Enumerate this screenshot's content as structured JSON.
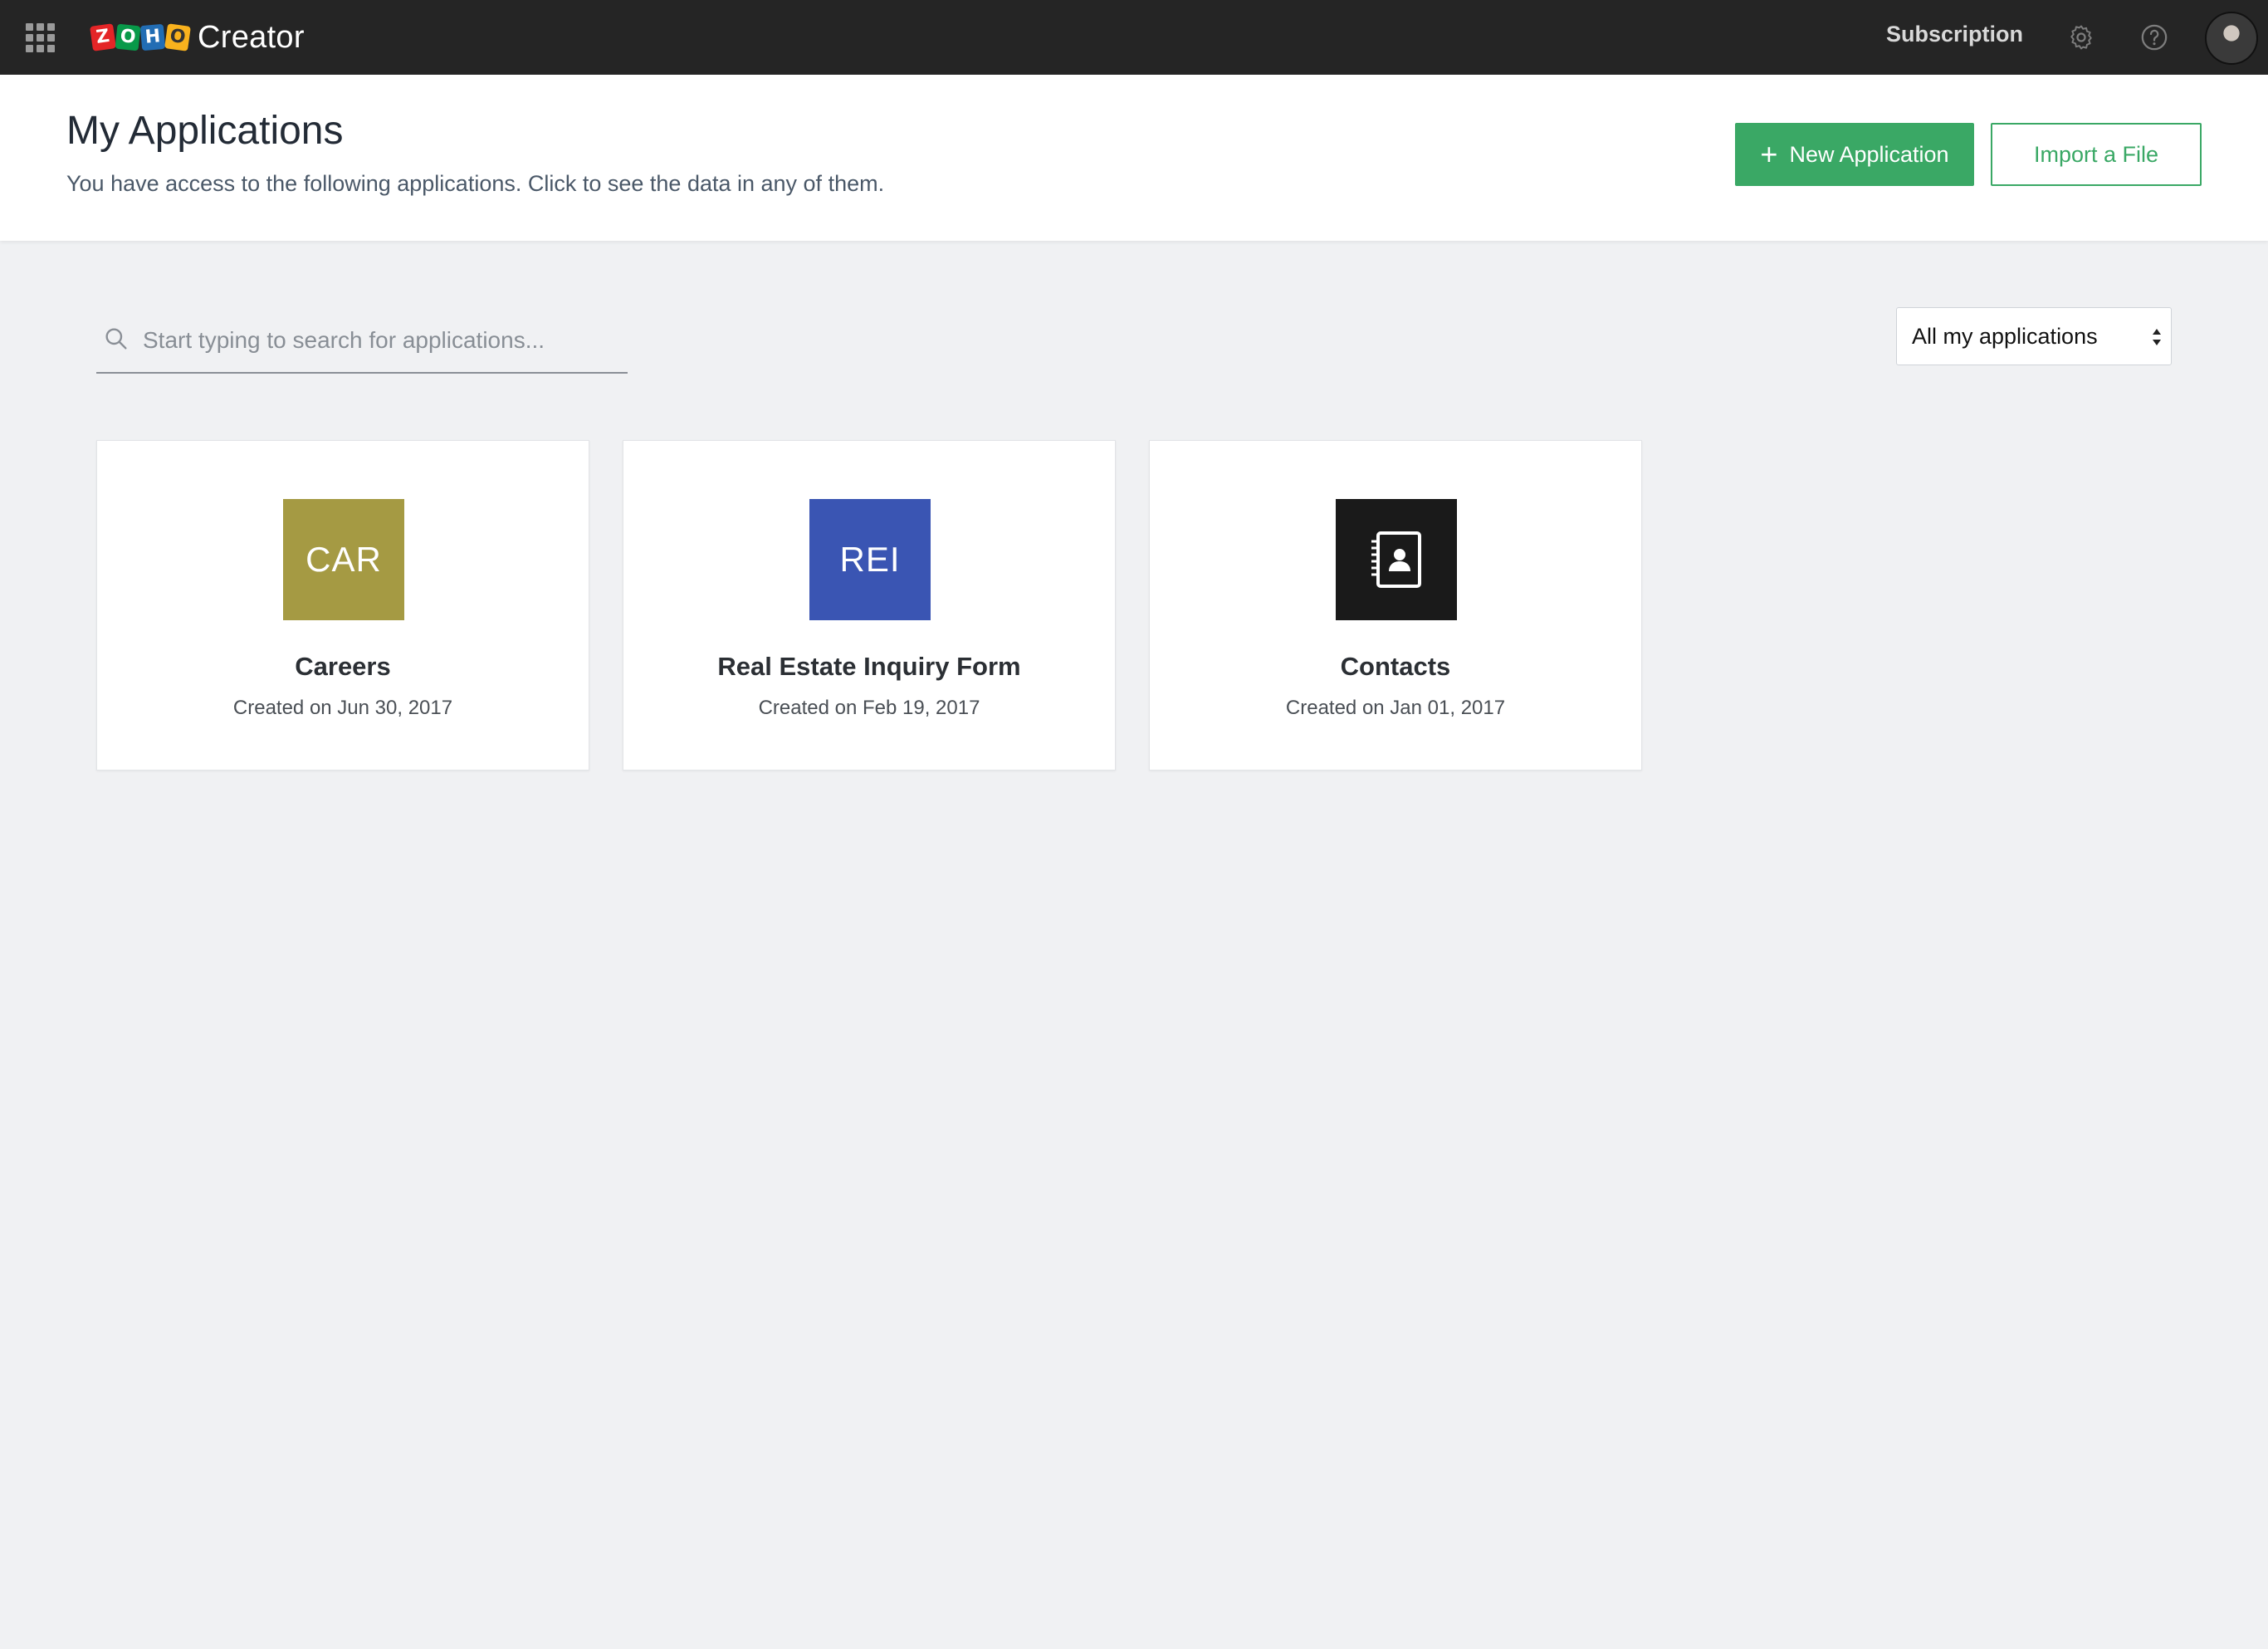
{
  "topbar": {
    "product_name": "Creator",
    "logo_letters": [
      "Z",
      "O",
      "H",
      "O"
    ],
    "subscription_label": "Subscription",
    "icons": {
      "apps": "grid-icon",
      "settings": "gear-icon",
      "help": "question-circle-icon"
    }
  },
  "header": {
    "title": "My Applications",
    "subtitle": "You have access to the following applications. Click to see the data in any of them.",
    "new_app_label": "New Application",
    "new_app_icon": "+",
    "import_label": "Import a File"
  },
  "search": {
    "placeholder": "Start typing to search for applications...",
    "value": ""
  },
  "filter": {
    "selected": "All my applications"
  },
  "colors": {
    "accent": "#3aa865",
    "topbar": "#252525",
    "background": "#f0f1f3"
  },
  "apps": [
    {
      "name": "Careers",
      "icon_text": "CAR",
      "icon_color": "#a59a43",
      "created": "Created on Jun 30, 2017"
    },
    {
      "name": "Real Estate Inquiry Form",
      "icon_text": "REI",
      "icon_color": "#3a55b3",
      "created": "Created on Feb 19, 2017"
    },
    {
      "name": "Contacts",
      "icon_text": "",
      "icon": "contact-book-icon",
      "icon_color": "#1a1a1a",
      "created": "Created on Jan 01, 2017"
    }
  ]
}
